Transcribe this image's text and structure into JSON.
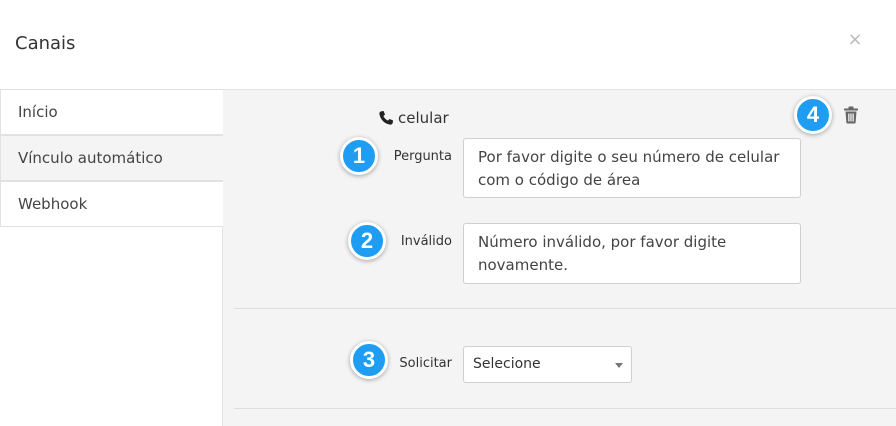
{
  "modal": {
    "title": "Canais",
    "close_label": "×"
  },
  "sidebar": {
    "items": [
      {
        "label": "Início",
        "active": false
      },
      {
        "label": "Vínculo automático",
        "active": true
      },
      {
        "label": "Webhook",
        "active": false
      }
    ]
  },
  "channel": {
    "name": "celular",
    "icon": "phone-icon",
    "pergunta_label": "Pergunta",
    "pergunta_value": "Por favor digite o seu número de celular com o código de área",
    "invalido_label": "Inválido",
    "invalido_value": "Número inválido, por favor digite novamente.",
    "solicitar_label": "Solicitar",
    "solicitar_value": "Selecione",
    "delete_icon": "trash-icon"
  },
  "badges": [
    "1",
    "2",
    "3",
    "4"
  ],
  "colors": {
    "badge": "#1e9df2",
    "content_bg": "#f4f4f4",
    "border": "#cfcfcf"
  }
}
